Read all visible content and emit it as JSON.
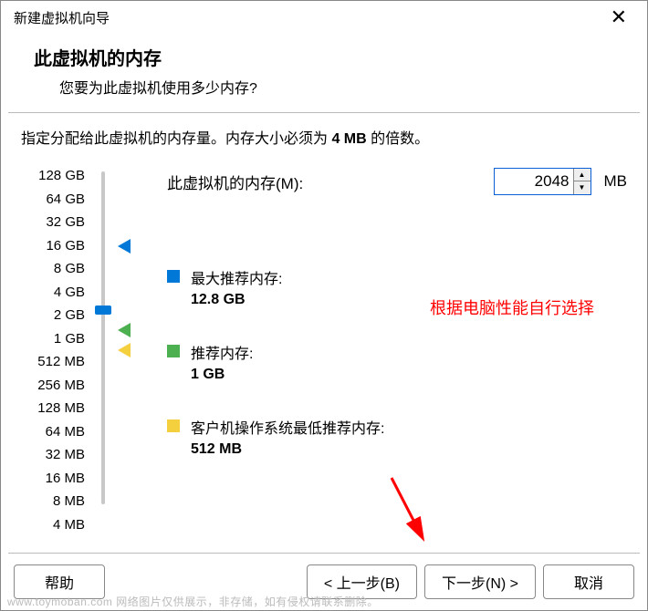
{
  "window": {
    "title": "新建虚拟机向导"
  },
  "header": {
    "h1": "此虚拟机的内存",
    "sub": "您要为此虚拟机使用多少内存?"
  },
  "desc": {
    "prefix": "指定分配给此虚拟机的内存量。内存大小必须为 ",
    "bold": "4 MB",
    "suffix": " 的倍数。"
  },
  "memory": {
    "label": "此虚拟机的内存(M):",
    "value": "2048",
    "unit": "MB"
  },
  "scale": {
    "labels": [
      "128 GB",
      "64 GB",
      "32 GB",
      "16 GB",
      "8 GB",
      "4 GB",
      "2 GB",
      "1 GB",
      "512 MB",
      "256 MB",
      "128 MB",
      "64 MB",
      "32 MB",
      "16 MB",
      "8 MB",
      "4 MB"
    ]
  },
  "legends": {
    "max": {
      "title": "最大推荐内存:",
      "value": "12.8 GB"
    },
    "rec": {
      "title": "推荐内存:",
      "value": "1 GB"
    },
    "min": {
      "title": "客户机操作系统最低推荐内存:",
      "value": "512 MB"
    }
  },
  "annotation": "根据电脑性能自行选择",
  "buttons": {
    "help": "帮助",
    "back": "< 上一步(B)",
    "next": "下一步(N) >",
    "cancel": "取消"
  },
  "watermark": "www.toymoban.com  网络图片仅供展示，非存储，如有侵权请联系删除。"
}
